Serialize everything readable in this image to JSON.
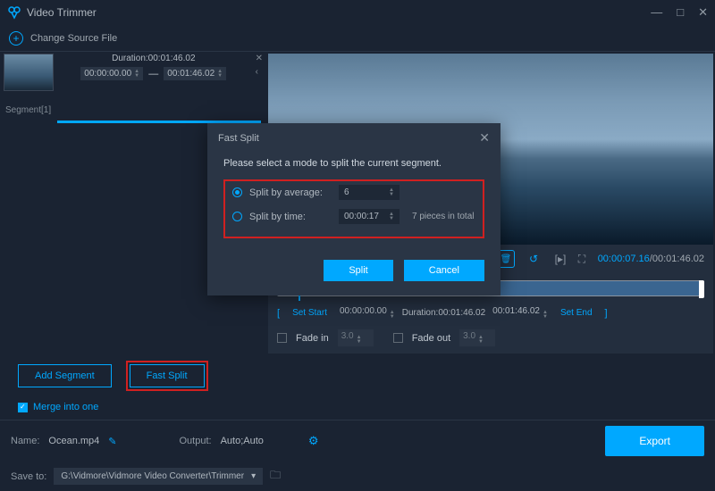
{
  "titlebar": {
    "title": "Video Trimmer"
  },
  "toolbar": {
    "change_source": "Change Source File"
  },
  "segment": {
    "duration_label": "Duration:",
    "duration_value": "00:01:46.02",
    "start": "00:00:00.00",
    "end": "00:01:46.02",
    "dash": "—",
    "name": "Segment[1]"
  },
  "dialog": {
    "title": "Fast Split",
    "prompt": "Please select a mode to split the current segment.",
    "by_average_label": "Split by average:",
    "by_average_value": "6",
    "by_time_label": "Split by time:",
    "by_time_value": "00:00:17",
    "pieces_note": "7 pieces in total",
    "split_btn": "Split",
    "cancel_btn": "Cancel"
  },
  "player": {
    "current_time": "00:00:07.16",
    "total_time": "00:01:46.02"
  },
  "range": {
    "set_start": "Set Start",
    "start_val": "00:00:00.00",
    "duration_label": "Duration:",
    "duration_val": "00:01:46.02",
    "end_val": "00:01:46.02",
    "set_end": "Set End"
  },
  "fade": {
    "in_label": "Fade in",
    "in_val": "3.0",
    "out_label": "Fade out",
    "out_val": "3.0"
  },
  "buttons": {
    "add_segment": "Add Segment",
    "fast_split": "Fast Split",
    "merge": "Merge into one",
    "export": "Export"
  },
  "output": {
    "name_label": "Name:",
    "name_val": "Ocean.mp4",
    "output_label": "Output:",
    "output_val": "Auto;Auto",
    "save_label": "Save to:",
    "save_path": "G:\\Vidmore\\Vidmore Video Converter\\Trimmer"
  }
}
